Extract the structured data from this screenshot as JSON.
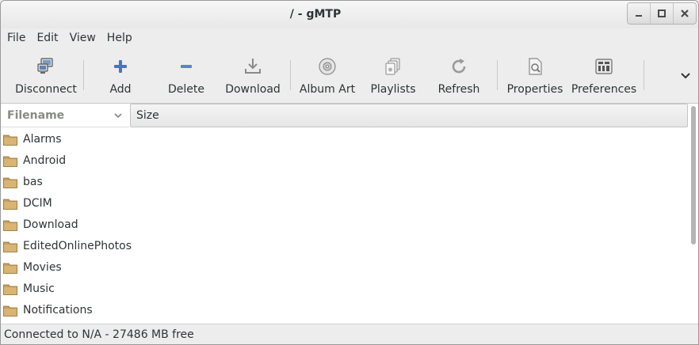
{
  "window": {
    "title": "/ - gMTP"
  },
  "menubar": {
    "items": [
      "File",
      "Edit",
      "View",
      "Help"
    ]
  },
  "toolbar": {
    "buttons": [
      {
        "label": "Disconnect",
        "icon": "disconnect-icon"
      },
      {
        "label": "Add",
        "icon": "add-icon"
      },
      {
        "label": "Delete",
        "icon": "delete-icon"
      },
      {
        "label": "Download",
        "icon": "download-icon"
      },
      {
        "label": "Album Art",
        "icon": "album-art-icon"
      },
      {
        "label": "Playlists",
        "icon": "playlists-icon"
      },
      {
        "label": "Refresh",
        "icon": "refresh-icon"
      },
      {
        "label": "Properties",
        "icon": "properties-icon"
      },
      {
        "label": "Preferences",
        "icon": "preferences-icon"
      }
    ]
  },
  "filelist": {
    "columns": {
      "filename": "Filename",
      "size": "Size"
    },
    "rows": [
      {
        "name": "Alarms"
      },
      {
        "name": "Android"
      },
      {
        "name": "bas"
      },
      {
        "name": "DCIM"
      },
      {
        "name": "Download"
      },
      {
        "name": "EditedOnlinePhotos"
      },
      {
        "name": "Movies"
      },
      {
        "name": "Music"
      },
      {
        "name": "Notifications"
      }
    ]
  },
  "statusbar": {
    "text": "Connected to N/A - 27486 MB free"
  },
  "colors": {
    "folder": "#c8a060",
    "add_blue": "#3f78c8",
    "delete_blue": "#5a85c4"
  }
}
